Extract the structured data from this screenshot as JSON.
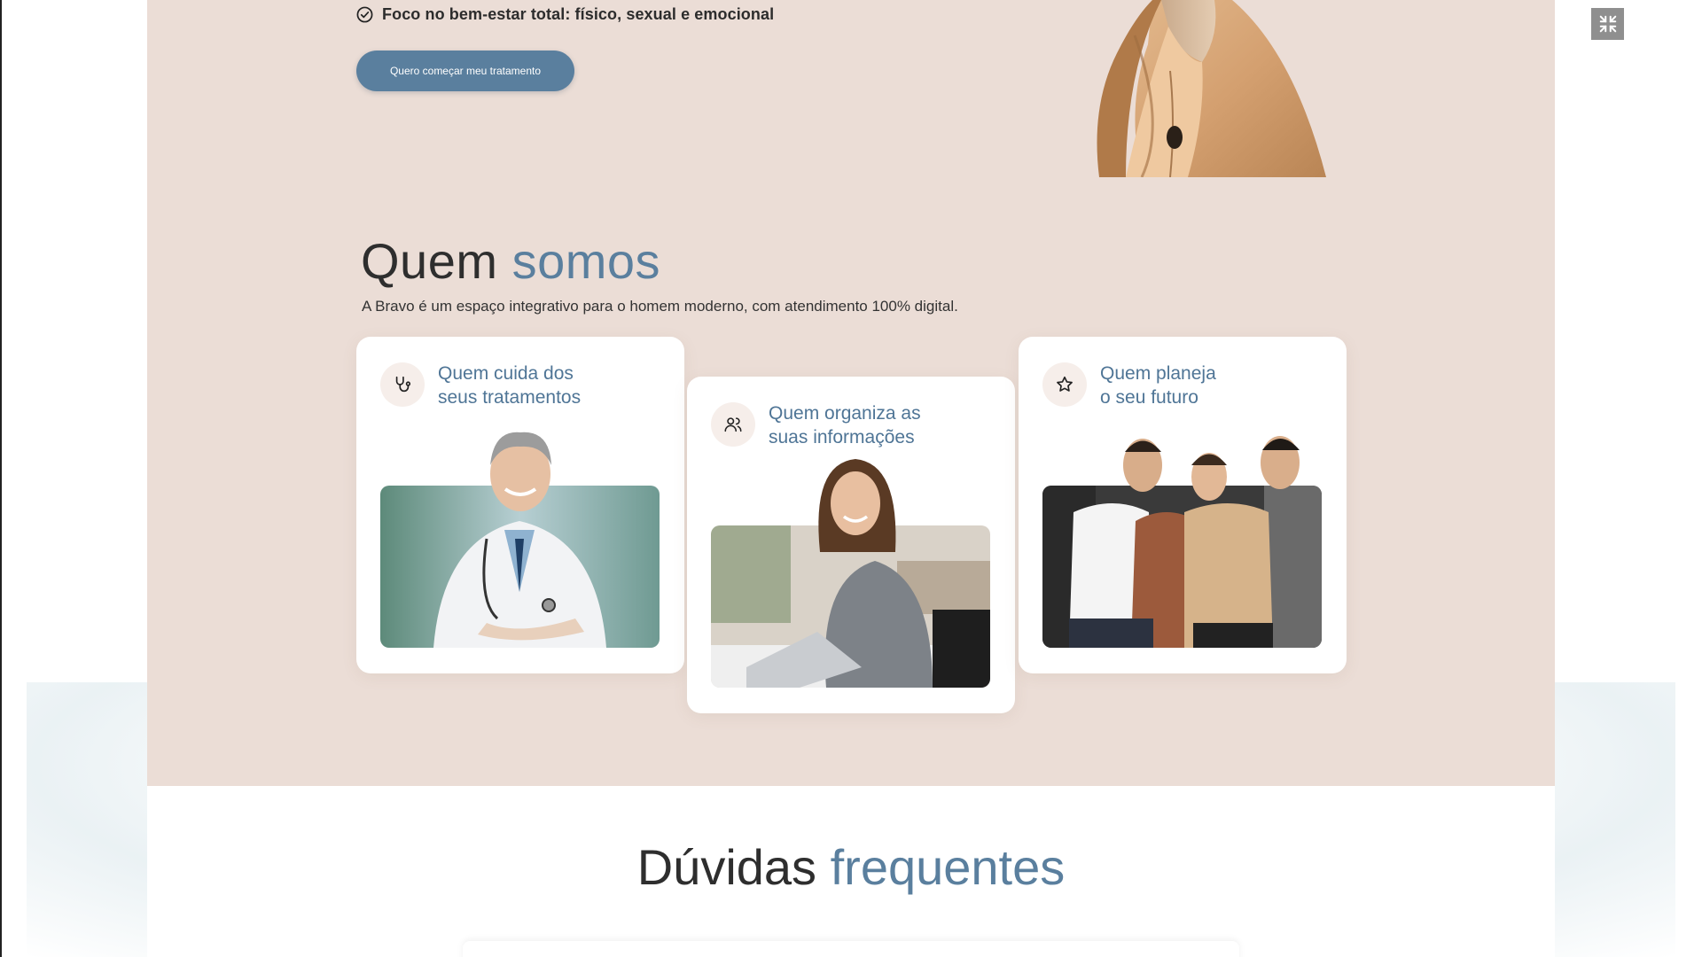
{
  "hero": {
    "feature_text": "Foco no bem-estar total: físico, sexual e emocional",
    "cta_label": "Quero começar meu tratamento"
  },
  "about": {
    "title_plain": "Quem",
    "title_accent": "somos",
    "subtitle": "A Bravo é um espaço integrativo para o homem moderno, com atendimento 100% digital.",
    "cards": [
      {
        "icon": "stethoscope-icon",
        "title_line1": "Quem cuida dos",
        "title_line2": "seus tratamentos"
      },
      {
        "icon": "users-icon",
        "title_line1": "Quem organiza as",
        "title_line2": "suas informações"
      },
      {
        "icon": "star-icon",
        "title_line1": "Quem planeja",
        "title_line2": "o seu futuro"
      }
    ]
  },
  "faq": {
    "title_plain": "Dúvidas",
    "title_accent": "frequentes"
  },
  "colors": {
    "hero_bg": "#ebddd6",
    "accent": "#5a7f9e",
    "card_bg": "#ffffff",
    "icon_bg": "#f6eeea"
  },
  "controls": {
    "exit_fullscreen_icon": "exit-fullscreen-icon"
  }
}
